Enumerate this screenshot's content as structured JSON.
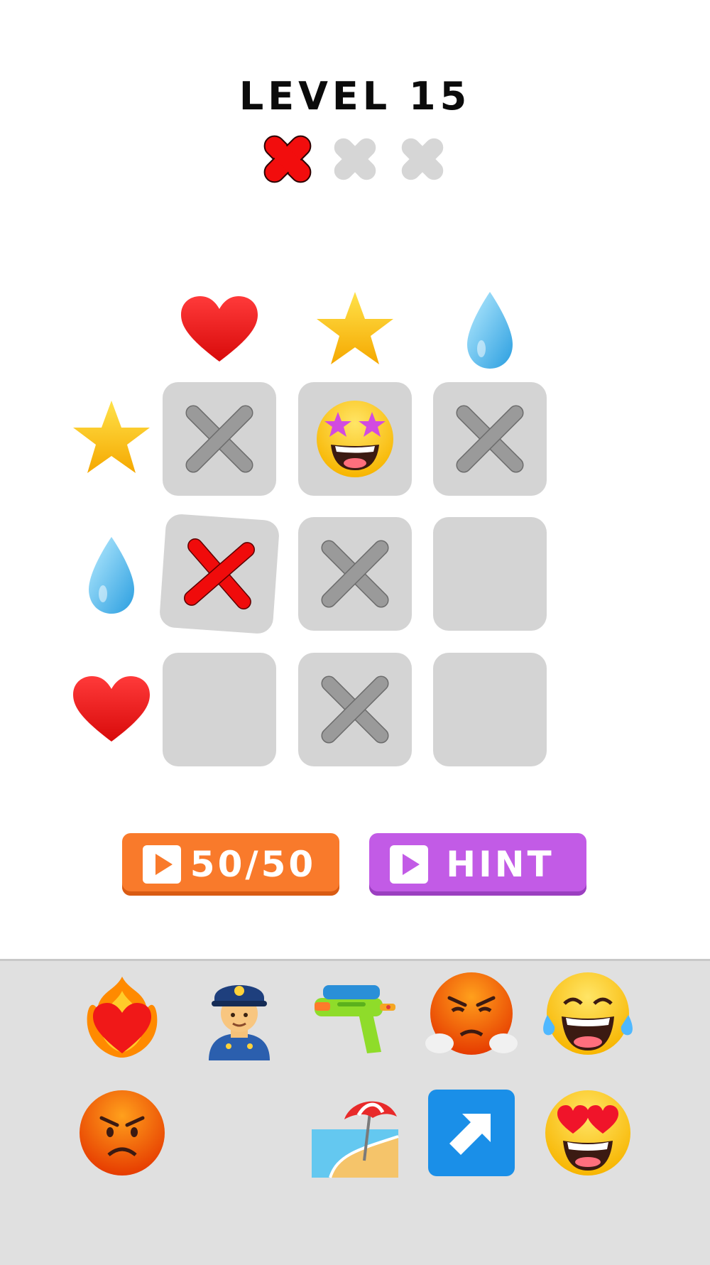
{
  "header": {
    "level_title": "LEVEL 15"
  },
  "lives": {
    "total": 3,
    "used": 1,
    "used_color": "#f20d0d",
    "unused_color": "#d6d6d6"
  },
  "grid": {
    "column_clues": [
      "heart-icon",
      "star-icon",
      "droplet-icon"
    ],
    "row_clues": [
      "star-icon",
      "droplet-icon",
      "heart-icon"
    ],
    "cells": [
      [
        "gray-x",
        "star-struck-emoji",
        "gray-x"
      ],
      [
        "red-x-wrong",
        "gray-x",
        "empty"
      ],
      [
        "empty",
        "gray-x",
        "empty"
      ]
    ]
  },
  "buttons": {
    "fifty_label": "50/50",
    "hint_label": "HINT",
    "fifty_color": "#f97a2b",
    "hint_color": "#c25be6"
  },
  "tray": {
    "items": [
      "heart-on-fire-icon",
      "police-officer-icon",
      "water-pistol-icon",
      "face-with-steam-icon",
      "tears-of-joy-icon",
      "angry-face-icon",
      "beach-umbrella-icon",
      "up-right-arrow-icon",
      "heart-eyes-icon"
    ]
  }
}
